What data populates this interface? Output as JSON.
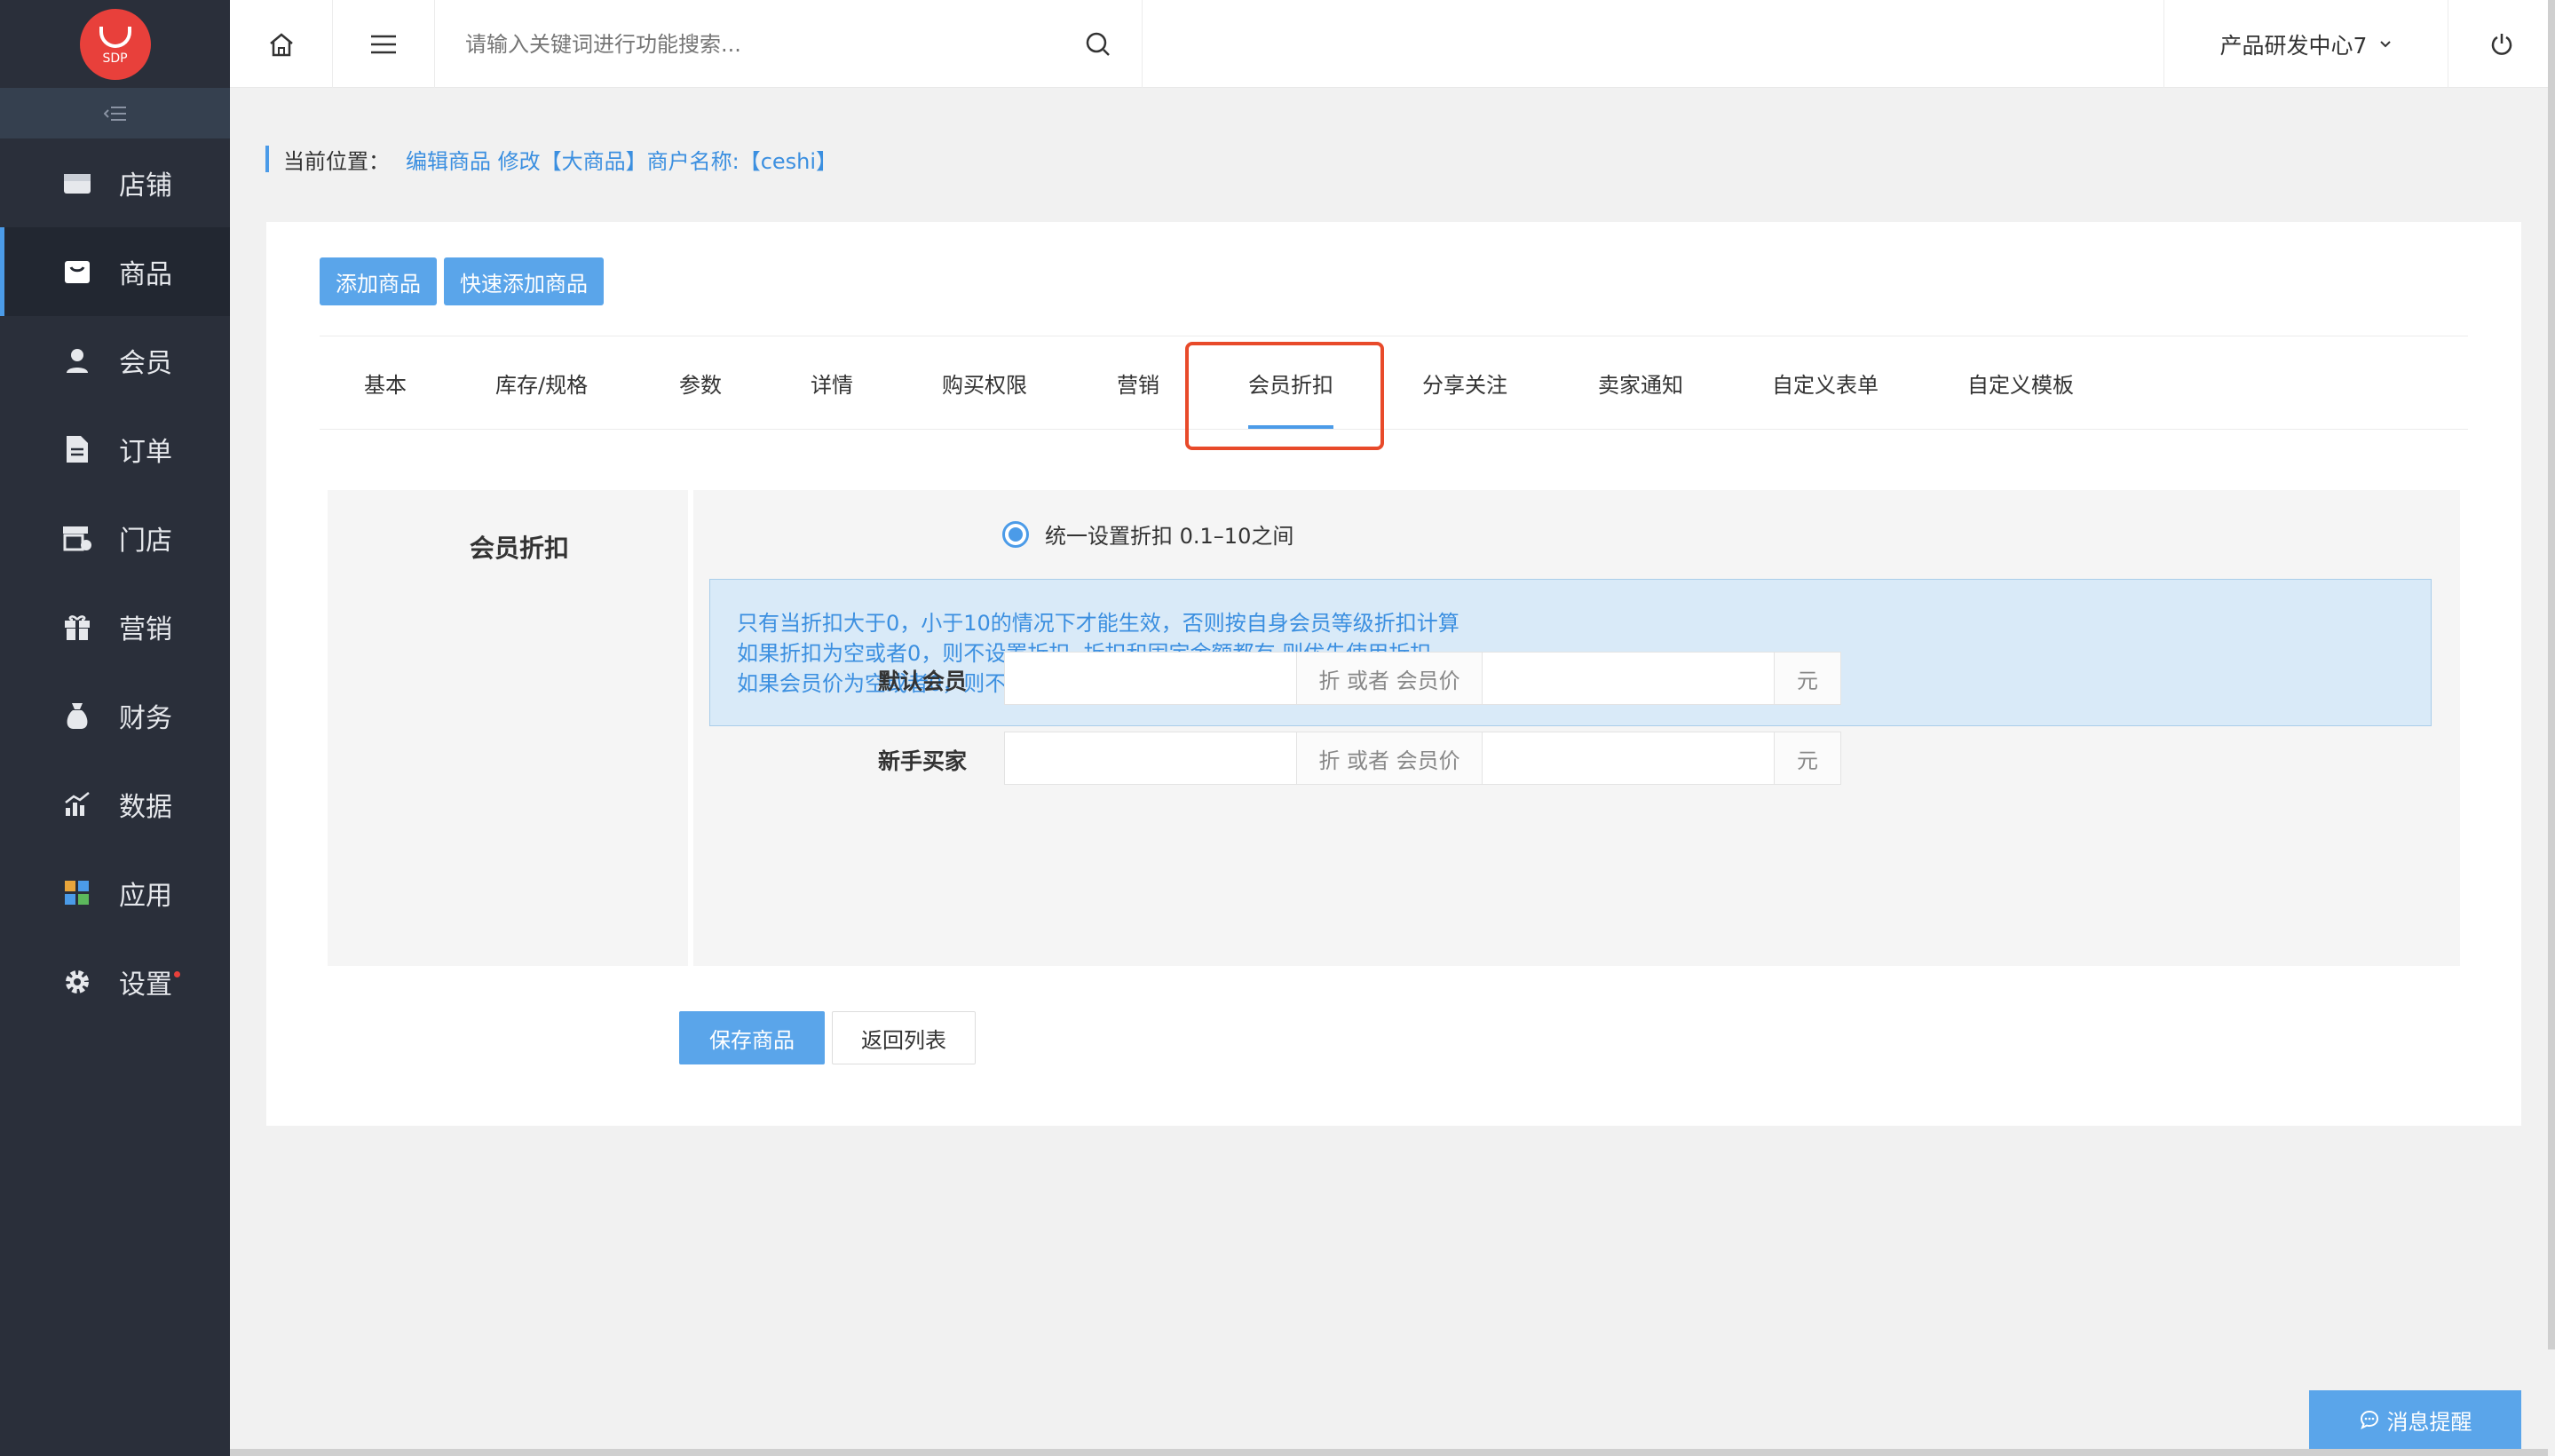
{
  "logo": {
    "text": "SDP"
  },
  "sidebar": {
    "items": [
      {
        "label": "店铺",
        "icon": "store-icon"
      },
      {
        "label": "商品",
        "icon": "goods-icon",
        "active": true
      },
      {
        "label": "会员",
        "icon": "member-icon"
      },
      {
        "label": "订单",
        "icon": "order-icon"
      },
      {
        "label": "门店",
        "icon": "shop-icon"
      },
      {
        "label": "营销",
        "icon": "gift-icon"
      },
      {
        "label": "财务",
        "icon": "money-bag-icon"
      },
      {
        "label": "数据",
        "icon": "chart-icon"
      },
      {
        "label": "应用",
        "icon": "apps-icon"
      },
      {
        "label": "设置",
        "icon": "gear-icon",
        "badge": true
      }
    ]
  },
  "header": {
    "search_placeholder": "请输入关键词进行功能搜索...",
    "org_name": "产品研发中心7"
  },
  "breadcrumb": {
    "label": "当前位置：",
    "path": "编辑商品 修改【大商品】商户名称:【ceshi】"
  },
  "toolbar": {
    "add_label": "添加商品",
    "quick_add_label": "快速添加商品"
  },
  "tabs": [
    {
      "label": "基本"
    },
    {
      "label": "库存/规格"
    },
    {
      "label": "参数"
    },
    {
      "label": "详情"
    },
    {
      "label": "购买权限"
    },
    {
      "label": "营销"
    },
    {
      "label": "会员折扣",
      "active": true
    },
    {
      "label": "分享关注"
    },
    {
      "label": "卖家通知"
    },
    {
      "label": "自定义表单"
    },
    {
      "label": "自定义模板"
    }
  ],
  "form": {
    "section_title": "会员折扣",
    "radio_label": "统一设置折扣 0.1–10之间",
    "notice": [
      "只有当折扣大于0，小于10的情况下才能生效，否则按自身会员等级折扣计算",
      "如果折扣为空或者0，则不设置折扣, 折扣和固定金额都有,则优先使用折扣",
      "如果会员价为空或者0，则不设置会员价"
    ],
    "rows": [
      {
        "label": "默认会员",
        "discount_value": "",
        "addon": "折 或者 会员价",
        "price_value": "",
        "unit": "元"
      },
      {
        "label": "新手买家",
        "discount_value": "",
        "addon": "折 或者 会员价",
        "price_value": "",
        "unit": "元"
      }
    ],
    "save_label": "保存商品",
    "back_label": "返回列表"
  },
  "message_button": "消息提醒",
  "colors": {
    "accent": "#4b9be8",
    "sidebar_bg": "#2a2f3a",
    "highlight": "#e84a2a",
    "logo": "#e8403b"
  }
}
